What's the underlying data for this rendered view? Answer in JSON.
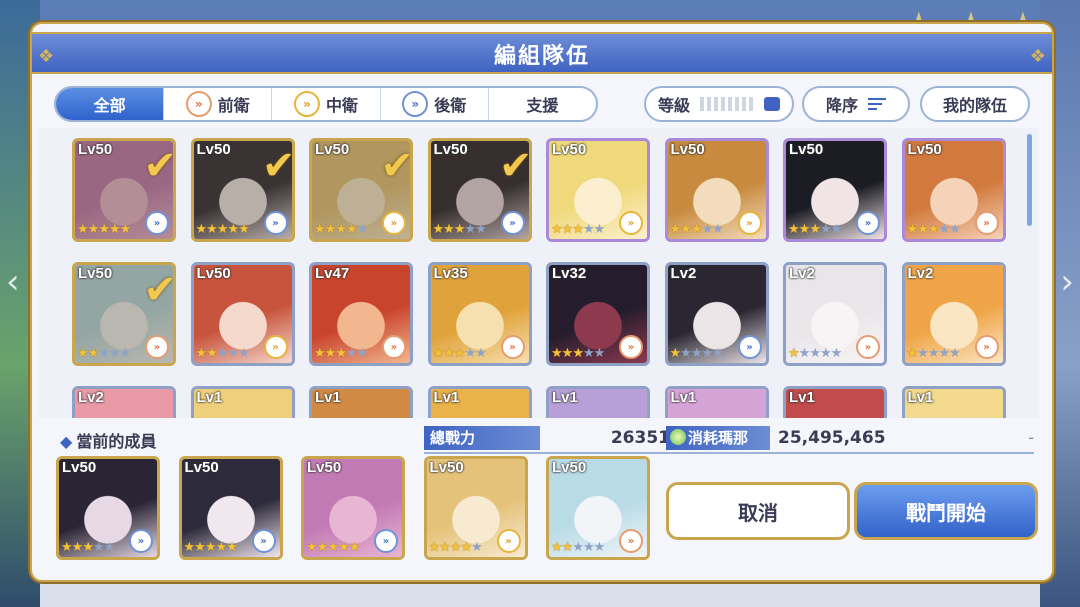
{
  "title": "編組隊伍",
  "tabs": [
    {
      "label": "全部",
      "active": true,
      "icon": ""
    },
    {
      "label": "前衛",
      "active": false,
      "icon": "front-role-icon"
    },
    {
      "label": "中衛",
      "active": false,
      "icon": "mid-role-icon"
    },
    {
      "label": "後衛",
      "active": false,
      "icon": "back-role-icon"
    },
    {
      "label": "支援",
      "active": false,
      "icon": ""
    }
  ],
  "filters": {
    "level": "等級",
    "sort": "降序",
    "my_party": "我的隊伍"
  },
  "roster": [
    {
      "level": "Lv50",
      "stars": 5,
      "role": "back",
      "selected": true,
      "frame": "gold",
      "art": [
        "#c27ab4",
        "#e8b5d2"
      ]
    },
    {
      "level": "Lv50",
      "stars": 5,
      "role": "back",
      "selected": true,
      "frame": "gold",
      "art": [
        "#2d2a3b",
        "#f1e8ef"
      ]
    },
    {
      "level": "Lv50",
      "stars": 4,
      "role": "mid",
      "selected": true,
      "frame": "gold",
      "art": [
        "#e5c27a",
        "#f7ead0"
      ]
    },
    {
      "level": "Lv50",
      "stars": 3,
      "role": "back",
      "selected": true,
      "frame": "gold",
      "art": [
        "#2a2434",
        "#e6d8e4"
      ]
    },
    {
      "level": "Lv50",
      "stars": 3,
      "role": "mid",
      "selected": false,
      "frame": "purple",
      "art": [
        "#f0d97a",
        "#fcefcf"
      ]
    },
    {
      "level": "Lv50",
      "stars": 3,
      "role": "mid",
      "selected": false,
      "frame": "purple",
      "art": [
        "#c78a3f",
        "#f3dcbc"
      ]
    },
    {
      "level": "Lv50",
      "stars": 3,
      "role": "back",
      "selected": false,
      "frame": "purple",
      "art": [
        "#1c1c24",
        "#f0e4e4"
      ]
    },
    {
      "level": "Lv50",
      "stars": 3,
      "role": "front",
      "selected": false,
      "frame": "purple",
      "art": [
        "#d27a3e",
        "#f6d2b8"
      ]
    },
    {
      "level": "Lv50",
      "stars": 2,
      "role": "front",
      "selected": true,
      "frame": "gold",
      "art": [
        "#b9dbe6",
        "#f1f5f8"
      ]
    },
    {
      "level": "Lv50",
      "stars": 2,
      "role": "mid",
      "selected": false,
      "frame": "silver",
      "art": [
        "#c8543d",
        "#f5d9cd"
      ]
    },
    {
      "level": "Lv47",
      "stars": 3,
      "role": "front",
      "selected": false,
      "frame": "silver",
      "art": [
        "#c9442d",
        "#f2b78f"
      ]
    },
    {
      "level": "Lv35",
      "stars": 3,
      "role": "front",
      "selected": false,
      "frame": "silver",
      "art": [
        "#e0a23a",
        "#f7e0b0"
      ]
    },
    {
      "level": "Lv32",
      "stars": 3,
      "role": "front",
      "selected": false,
      "frame": "silver",
      "art": [
        "#251d2d",
        "#8d3a4f"
      ]
    },
    {
      "level": "Lv2",
      "stars": 1,
      "role": "back",
      "selected": false,
      "frame": "silver",
      "art": [
        "#2a2732",
        "#ece5e8"
      ]
    },
    {
      "level": "Lv2",
      "stars": 1,
      "role": "front",
      "selected": false,
      "frame": "silver",
      "art": [
        "#e9e6ea",
        "#f8f4f5"
      ]
    },
    {
      "level": "Lv2",
      "stars": 1,
      "role": "front",
      "selected": false,
      "frame": "silver",
      "art": [
        "#efa547",
        "#fbe6c3"
      ]
    },
    {
      "level": "Lv2",
      "stars": 0,
      "role": "",
      "selected": false,
      "frame": "silver",
      "art": [
        "#e99aa6",
        "#f8d6dc"
      ]
    },
    {
      "level": "Lv1",
      "stars": 0,
      "role": "",
      "selected": false,
      "frame": "silver",
      "art": [
        "#f0cf7c",
        "#fbeec8"
      ]
    },
    {
      "level": "Lv1",
      "stars": 0,
      "role": "",
      "selected": false,
      "frame": "silver",
      "art": [
        "#d08a44",
        "#f5dbb6"
      ]
    },
    {
      "level": "Lv1",
      "stars": 0,
      "role": "",
      "selected": false,
      "frame": "silver",
      "art": [
        "#e9b24a",
        "#fbe8c1"
      ]
    },
    {
      "level": "Lv1",
      "stars": 0,
      "role": "",
      "selected": false,
      "frame": "silver",
      "art": [
        "#b7a0d8",
        "#e9def6"
      ]
    },
    {
      "level": "Lv1",
      "stars": 0,
      "role": "",
      "selected": false,
      "frame": "silver",
      "art": [
        "#d6a3d6",
        "#f4def4"
      ]
    },
    {
      "level": "Lv1",
      "stars": 0,
      "role": "",
      "selected": false,
      "frame": "silver",
      "art": [
        "#c24b4b",
        "#f2c7c7"
      ]
    },
    {
      "level": "Lv1",
      "stars": 0,
      "role": "",
      "selected": false,
      "frame": "silver",
      "art": [
        "#f2d98c",
        "#fcf2d6"
      ]
    }
  ],
  "current_members_label": "當前的成員",
  "total_power_label": "總戰力",
  "total_power": "26351",
  "mana_cost_label": "消耗瑪那",
  "mana_cost": "25,495,465",
  "dash": "-",
  "members": [
    {
      "level": "Lv50",
      "stars": 3,
      "role": "back",
      "art": [
        "#2a2434",
        "#e6d8e4"
      ]
    },
    {
      "level": "Lv50",
      "stars": 5,
      "role": "back",
      "art": [
        "#2d2a3b",
        "#f1e8ef"
      ]
    },
    {
      "level": "Lv50",
      "stars": 5,
      "role": "back",
      "art": [
        "#c27ab4",
        "#e8b5d2"
      ]
    },
    {
      "level": "Lv50",
      "stars": 4,
      "role": "mid",
      "art": [
        "#e5c27a",
        "#f7ead0"
      ]
    },
    {
      "level": "Lv50",
      "stars": 2,
      "role": "front",
      "art": [
        "#b9dbe6",
        "#f1f5f8"
      ]
    }
  ],
  "buttons": {
    "cancel": "取消",
    "start": "戰鬥開始"
  },
  "colors": {
    "accent": "#3f63c2",
    "gold": "#c9a64e",
    "star": "#f4c13a"
  }
}
